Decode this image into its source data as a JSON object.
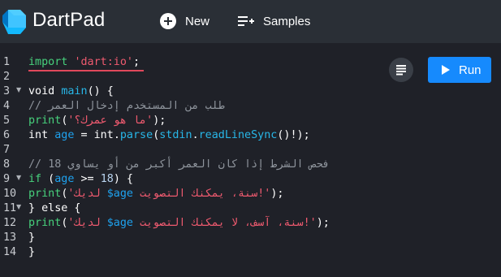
{
  "app": {
    "title": "DartPad",
    "logo_icon": "dart-logo-icon",
    "header_bg": "#2a2f36",
    "editor_bg": "#1f2128"
  },
  "toolbar": {
    "new_label": "New",
    "new_icon": "plus-circle-icon",
    "samples_label": "Samples",
    "samples_icon": "playlist-add-icon"
  },
  "actions": {
    "format_icon": "format-align-icon",
    "run_label": "Run",
    "run_icon": "play-icon",
    "run_color": "#168afd"
  },
  "editor": {
    "line_numbers": [
      "1",
      "2",
      "3",
      "4",
      "5",
      "6",
      "7",
      "8",
      "9",
      "10",
      "11",
      "12",
      "13",
      "14"
    ],
    "folded_lines": [
      "3",
      "9",
      "11"
    ],
    "error_line": "1",
    "code": {
      "l1_kw": "import",
      "l1_str": "'dart:io'",
      "l1_end": ";",
      "l3_type": "void",
      "l3_name": "main",
      "l3_rest": "() {",
      "l4_comment": "// طلب من المستخدم إدخال العمر",
      "l5_fn": "print",
      "l5_open": "(",
      "l5_str": "'ما هو عمرك؟'",
      "l5_close": ");",
      "l6_type": "int",
      "l6_var": "age",
      "l6_eq": " = ",
      "l6_type2": "int",
      "l6_dot": ".",
      "l6_parse": "parse",
      "l6_open": "(",
      "l6_stdin": "stdin",
      "l6_dot2": ".",
      "l6_read": "readLineSync",
      "l6_close": "()!);",
      "l8_comment": "// فحص الشرط إذا كان العمر أكبر من أو يساوي 18",
      "l9_if": "if",
      "l9_open": " (",
      "l9_var": "age",
      "l9_op": " >= ",
      "l9_num": "18",
      "l9_close": ") {",
      "l10_fn": "print",
      "l10_open": "(",
      "l10_str1": "'لديك ",
      "l10_interp": "$age",
      "l10_str2": " سنة، يمكنك التصويت!'",
      "l10_close": ");",
      "l11_a": "} ",
      "l11_else": "else",
      "l11_b": " {",
      "l12_fn": "print",
      "l12_open": "(",
      "l12_str1": "'لديك ",
      "l12_interp": "$age",
      "l12_str2": " سنة، آسف، لا يمكنك التصويت!'",
      "l12_close": ");",
      "l13": "}",
      "l14": "}"
    }
  }
}
